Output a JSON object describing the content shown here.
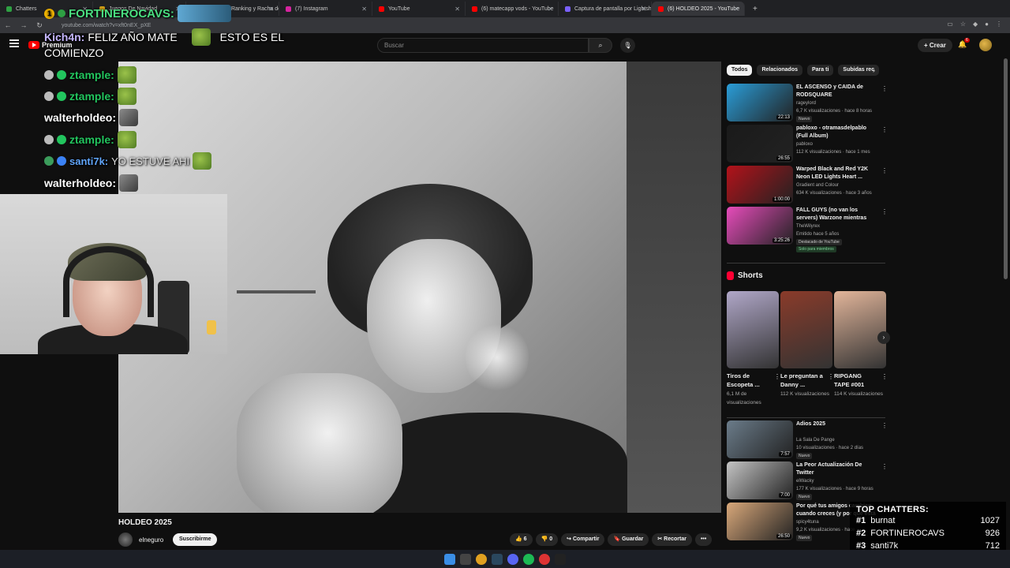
{
  "browser": {
    "tabs": [
      {
        "label": "Chatters",
        "fav": "#2ea043"
      },
      {
        "label": "Juegos De Navidad",
        "fav": "#d4a017"
      },
      {
        "label": "matecapp - Ranking y Racha de",
        "fav": "#888888"
      },
      {
        "label": "(7) Instagram",
        "fav": "#d6249f"
      },
      {
        "label": "YouTube",
        "fav": "#ff0000"
      },
      {
        "label": "(6) matecapp vods - YouTube",
        "fav": "#ff0000"
      },
      {
        "label": "Captura de pantalla por Lightsh",
        "fav": "#7b61ff"
      },
      {
        "label": "(6) HOLDEO 2025 - YouTube",
        "fav": "#ff0000"
      }
    ],
    "url": "youtube.com/watch?v=xft0nEX_pXE"
  },
  "masthead": {
    "logo_label": "Premium",
    "search_placeholder": "Buscar",
    "create_label": "Crear",
    "notif_count": "6"
  },
  "chat": {
    "lines": [
      {
        "user": "FORTINEROCAVS:",
        "msg": ""
      },
      {
        "user": "Kich4n:",
        "msg": "FELIZ AÑO MATE",
        "msg2": "ESTO ES EL",
        "msg3": "COMIENZO"
      },
      {
        "user": "ztample:",
        "msg": ""
      },
      {
        "user": "ztample:",
        "msg": ""
      },
      {
        "user": "walterholdeo:",
        "msg": ""
      },
      {
        "user": "ztample:",
        "msg": ""
      },
      {
        "user": "santi7k:",
        "msg": "YO ESTUVE AHI"
      },
      {
        "user": "walterholdeo:",
        "msg": ""
      }
    ],
    "colors": {
      "fortinero": "#4ade80",
      "kich": "#c4b5fd",
      "ztample": "#22c55e",
      "walter": "#ffffff",
      "santi": "#60a5fa"
    }
  },
  "video": {
    "title": "HOLDEO 2025",
    "channel": "elneguro",
    "subscribe_label": "Suscribirme",
    "likes": "6",
    "dislikes": "0",
    "share_label": "Compartir",
    "save_label": "Guardar",
    "clip_label": "Recortar",
    "more_label": "•••"
  },
  "sidebar": {
    "chips": [
      "Todos",
      "Relacionados",
      "Para ti",
      "Subidas rec"
    ],
    "recs": [
      {
        "title": "EL ASCENSO y CAIDA de RODSQUARE",
        "channel": "rageylord",
        "stats": "6,7 K visualizaciones · hace 8 horas",
        "badge": "Nuevo",
        "duration": "22:13",
        "thumb": "#2a9dd8"
      },
      {
        "title": "pabloxo - otramasdelpablo (Full Album)",
        "channel": "pabloxo",
        "stats": "112 K visualizaciones · hace 1 mes",
        "badge": "",
        "duration": "26:55",
        "thumb": "#1a1a1a"
      },
      {
        "title": "Warped Black and Red Y2K Neon LED Lights Heart ...",
        "channel": "Gradient and Colour",
        "stats": "634 K visualizaciones · hace 3 años",
        "badge": "",
        "duration": "1:00:00",
        "thumb": "#b3121a"
      },
      {
        "title": "FALL GUYS (no van los servers) Warzone mientras co...",
        "channel": "TheWilyrex",
        "stats": "Emitido hace 5 años",
        "badge": "Destacado de YouTube",
        "duration": "3:25:26",
        "thumb": "#e74cbb",
        "members": "Solo para miembros"
      }
    ],
    "shorts_title": "Shorts",
    "shorts": [
      {
        "title": "Tiros de Escopeta ...",
        "views": "6,1 M de visualizaciones",
        "thumb": "#b0a7c8"
      },
      {
        "title": "Le preguntan a Danny ...",
        "views": "112 K visualizaciones",
        "thumb": "#8a3b2a"
      },
      {
        "title": "RIPGANG TAPE #001",
        "views": "114 K visualizaciones",
        "thumb": "#e2b59a"
      }
    ],
    "recs2": [
      {
        "title": "Adios 2025",
        "channel": "La Sala De Pange",
        "stats": "10 visualizaciones · hace 2 días",
        "badge": "Nuevo",
        "duration": "7:57",
        "thumb": "#6b7c8a"
      },
      {
        "title": "La Peor Actualización De Twitter",
        "channel": "elWacky",
        "stats": "177 K visualizaciones · hace 9 horas",
        "badge": "Nuevo",
        "duration": "7:00",
        "thumb": "#c4c4c4"
      },
      {
        "title": "Por qué tus amigos cambian cuando creces (y por qué está ...",
        "channel": "spicy4tuna",
        "stats": "9,2 K visualizaciones · hace ...",
        "badge": "Nuevo",
        "duration": "26:50",
        "thumb": "#d9a87a"
      }
    ]
  },
  "top_chatters": {
    "title": "TOP CHATTERS:",
    "rows": [
      {
        "rank": "#1",
        "name": "burnat",
        "count": "1027"
      },
      {
        "rank": "#2",
        "name": "FORTINEROCAVS",
        "count": "926"
      },
      {
        "rank": "#3",
        "name": "santi7k",
        "count": "712"
      }
    ]
  }
}
